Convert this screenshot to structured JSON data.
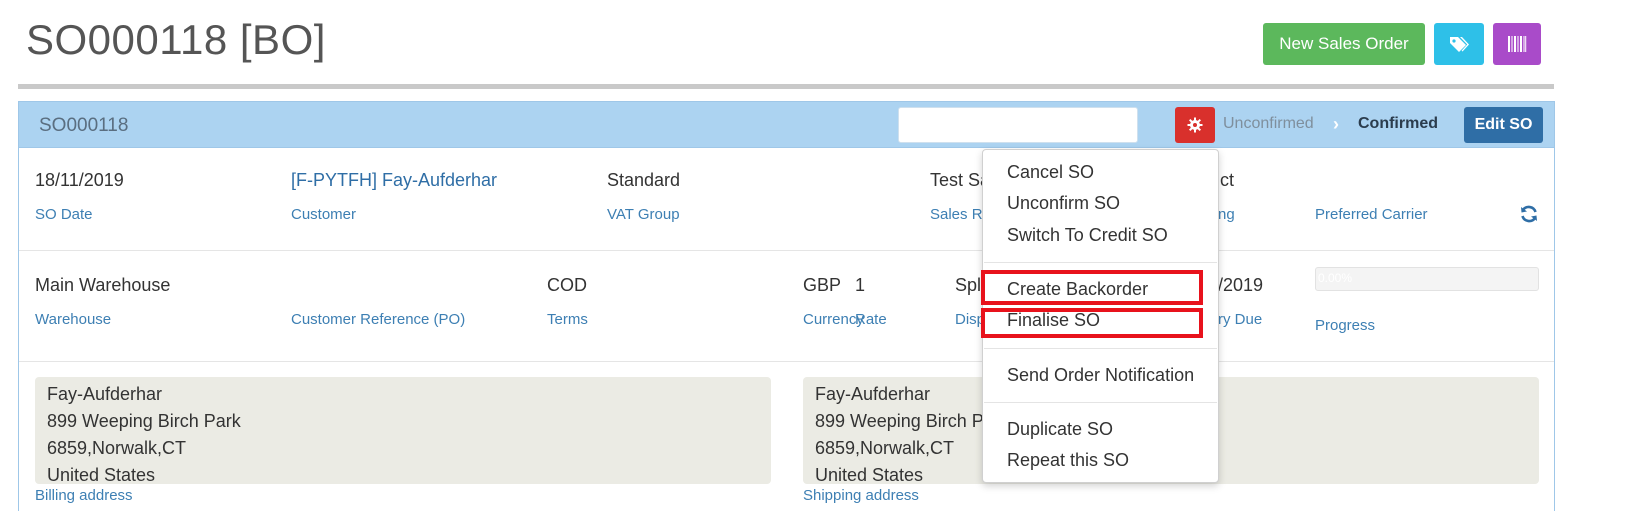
{
  "page": {
    "title": "SO000118 [BO]"
  },
  "toolbar": {
    "new_sales_order": "New Sales Order"
  },
  "header": {
    "so_ref": "SO000118",
    "search_value": "",
    "status_unconfirmed": "Unconfirmed",
    "status_chevron": "›",
    "status_confirmed": "Confirmed",
    "edit_label": "Edit SO"
  },
  "row1": {
    "so_date": {
      "value": "18/11/2019",
      "label": "SO Date"
    },
    "customer": {
      "value": "[F-PYTFH] Fay-Aufderhar",
      "label": "Customer"
    },
    "vat_group": {
      "value": "Standard",
      "label": "VAT Group"
    },
    "sales_rep": {
      "value": "Test Sa",
      "label": "Sales Re"
    },
    "col5": {
      "value": "ct",
      "label": "ng"
    },
    "preferred_carrier": {
      "value": "",
      "label": "Preferred Carrier"
    }
  },
  "row2": {
    "warehouse": {
      "value": "Main Warehouse",
      "label": "Warehouse"
    },
    "customer_reference": {
      "value": "",
      "label": "Customer Reference (PO)"
    },
    "terms": {
      "value": "COD",
      "label": "Terms"
    },
    "currency": {
      "value": "GBP",
      "label": "Currency"
    },
    "rate": {
      "value": "1",
      "label": "Rate"
    },
    "dispatch": {
      "value": "Spl",
      "label": "Disp"
    },
    "delivery_due": {
      "value": "/2019",
      "label": "ry Due"
    },
    "progress": {
      "value_text": "0.00%",
      "fraction": 0.0,
      "label": "Progress"
    }
  },
  "billing_address": {
    "lines": [
      "Fay-Aufderhar",
      "899 Weeping Birch Park",
      "6859,Norwalk,CT",
      "United States"
    ],
    "label": "Billing address"
  },
  "shipping_address": {
    "lines": [
      "Fay-Aufderhar",
      "899 Weeping Birch Pa",
      "6859,Norwalk,CT",
      "United States"
    ],
    "label": "Shipping address"
  },
  "dropdown": {
    "items": [
      "Cancel SO",
      "Unconfirm SO",
      "Switch To Credit SO",
      "Create Backorder",
      "Finalise SO",
      "Send Order Notification",
      "Duplicate SO",
      "Repeat this SO"
    ]
  },
  "colors": {
    "new_order_button": "#5cb85c",
    "tag_button": "#2ec0e8",
    "barcode_button": "#a94bc9",
    "gear_button": "#d9302c",
    "edit_button": "#2f6ea6",
    "panel_header": "#acd3f1",
    "highlight": "#e8121c"
  },
  "icons": {
    "tag": "tags-icon",
    "barcode": "barcode-icon",
    "gear": "gear-icon",
    "refresh": "refresh-icon"
  }
}
